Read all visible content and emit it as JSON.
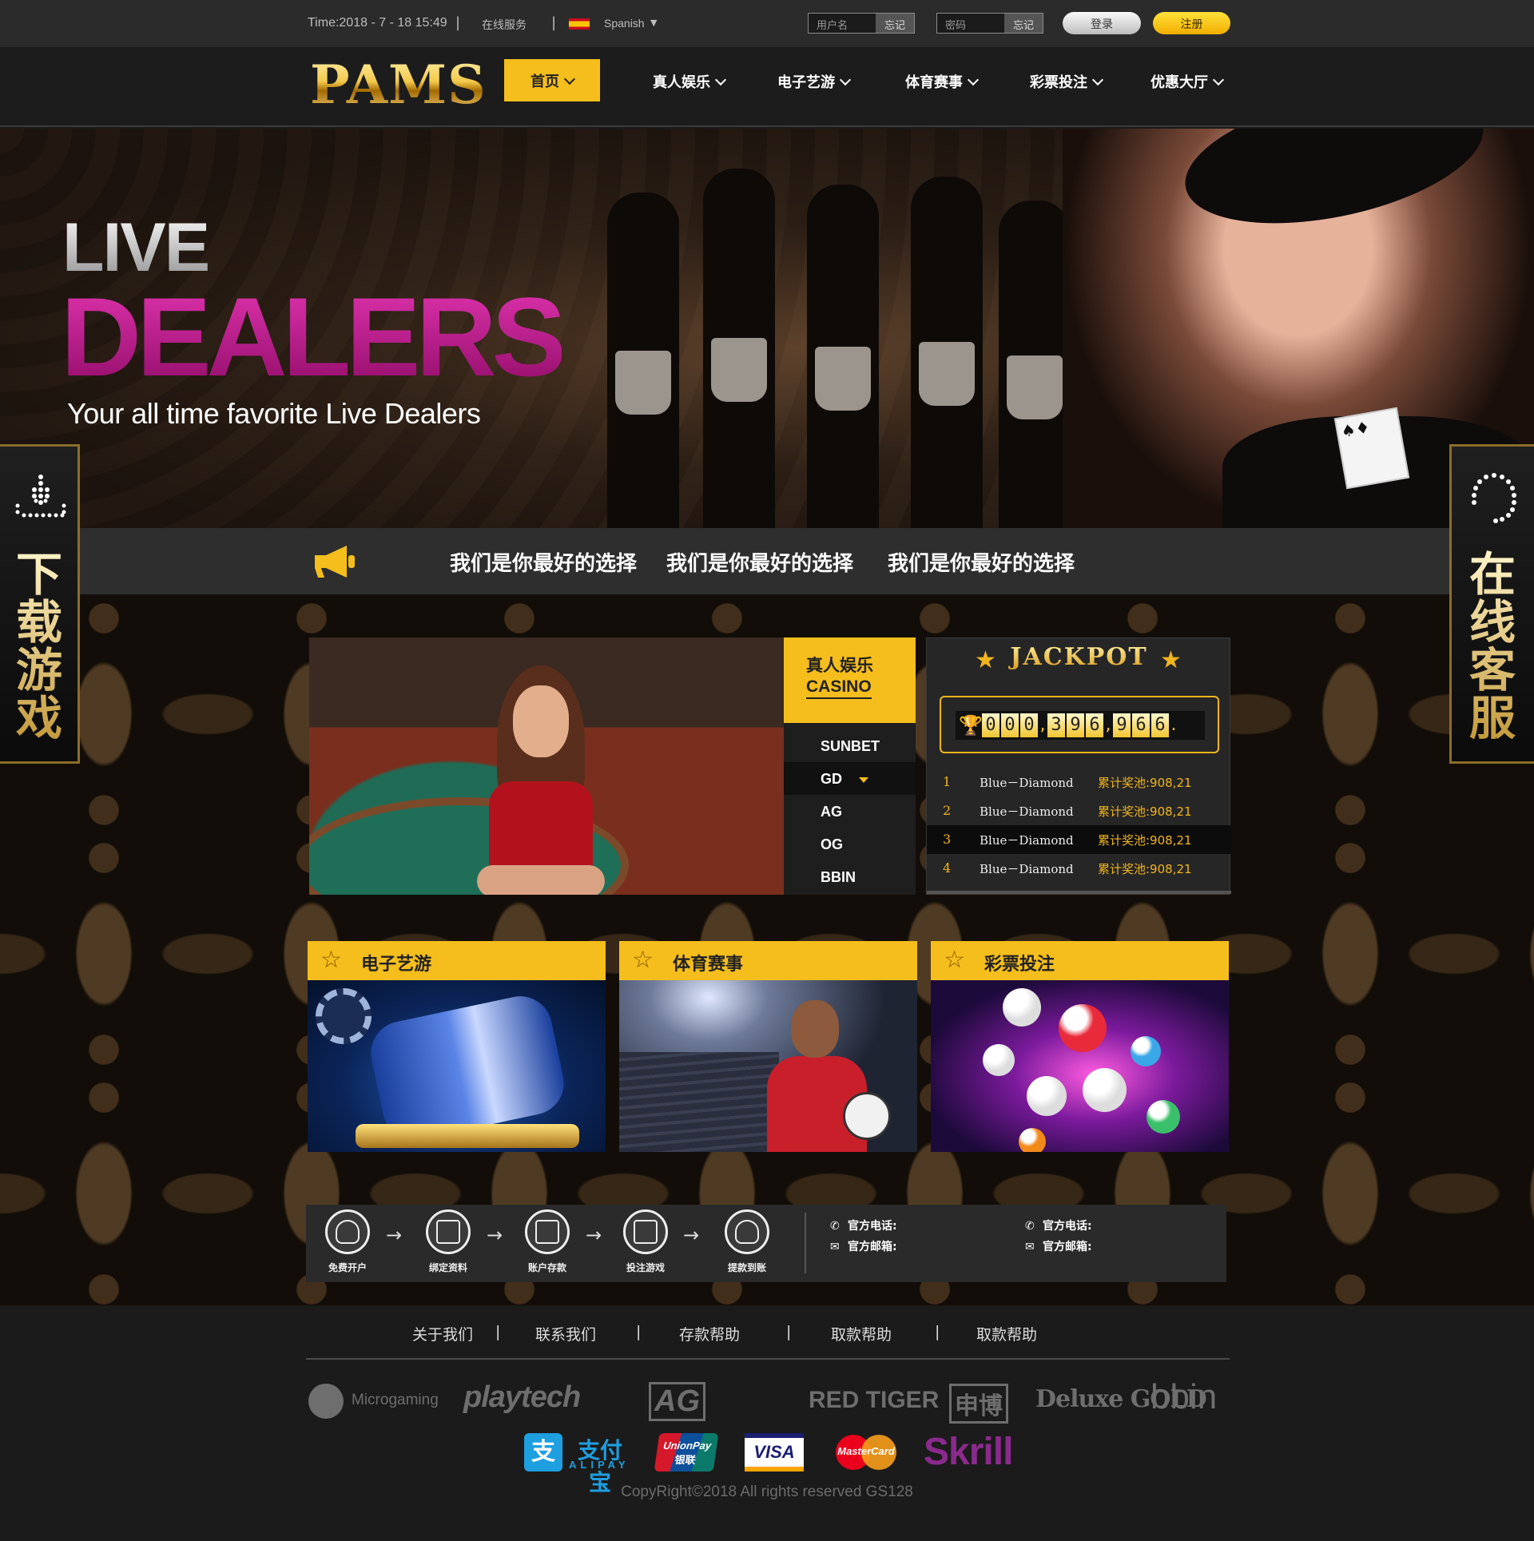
{
  "topbar": {
    "time": "Time:2018 - 7 - 18  15:49",
    "separator": "|",
    "service": "在线服务",
    "language": "Spanish",
    "username_placeholder": "用户名",
    "password_placeholder": "密码",
    "forgot_label": "忘记",
    "login_label": "登录",
    "register_label": "注册"
  },
  "nav": {
    "logo": "PAMS",
    "home": "首页",
    "items": [
      "真人娱乐",
      "电子艺游",
      "体育赛事",
      "彩票投注",
      "优惠大厅"
    ]
  },
  "banner": {
    "line1": "LIVE",
    "line2": "DEALERS",
    "subtitle": "Your all time favorite Live Dealers"
  },
  "marquee": {
    "messages": [
      "我们是你最好的选择",
      "我们是你最好的选择",
      "我们是你最好的选择"
    ]
  },
  "side_tabs": {
    "left": "下载游戏",
    "right": "在线客服"
  },
  "casino": {
    "title_cn": "真人娱乐",
    "title_en": "CASINO",
    "providers": [
      "SUNBET",
      "GD",
      "AG",
      "OG",
      "BBIN"
    ],
    "active_provider": "GD"
  },
  "jackpot": {
    "title": "JACKPOT",
    "digits": [
      "0",
      "0",
      "0",
      ",",
      "3",
      "9",
      "6",
      ",",
      "9",
      "6",
      "6",
      "."
    ],
    "rows": [
      {
        "rank": "1",
        "player": "Blue－Diamond",
        "value": "累计奖池:908,21"
      },
      {
        "rank": "2",
        "player": "Blue－Diamond",
        "value": "累计奖池:908,21"
      },
      {
        "rank": "3",
        "player": "Blue－Diamond",
        "value": "累计奖池:908,21"
      },
      {
        "rank": "4",
        "player": "Blue－Diamond",
        "value": "累计奖池:908,21"
      }
    ],
    "active_row": 3
  },
  "categories": [
    {
      "label": "电子艺游",
      "icon": "star-icon"
    },
    {
      "label": "体育赛事",
      "icon": "star-icon"
    },
    {
      "label": "彩票投注",
      "icon": "star-icon"
    }
  ],
  "steps": [
    {
      "label": "免费开户",
      "icon": "user-icon"
    },
    {
      "label": "绑定资料",
      "icon": "document-icon"
    },
    {
      "label": "账户存款",
      "icon": "id-card-icon"
    },
    {
      "label": "投注游戏",
      "icon": "cash-icon"
    },
    {
      "label": "提款到账",
      "icon": "withdraw-icon"
    }
  ],
  "contacts": {
    "phone_label": "官方电话:",
    "email_label": "官方邮箱:"
  },
  "footer": {
    "links": [
      "关于我们",
      "联系我们",
      "存款帮助",
      "取款帮助",
      "取款帮助"
    ],
    "separator": "|",
    "partners": [
      "Microgaming",
      "playtech",
      "AG",
      "RED TIGER",
      "申博",
      "Deluxe GOLD",
      "bbin"
    ],
    "payments": [
      "支付宝",
      "ALIPAY",
      "UnionPay",
      "银联",
      "VISA",
      "MasterCard",
      "Skrill"
    ],
    "copyright": "CopyRight©2018 All rights reserved GS128"
  },
  "colors": {
    "accent": "#f5be1c",
    "banner_magenta": "#c8239a",
    "dark": "#1b1b1b"
  }
}
